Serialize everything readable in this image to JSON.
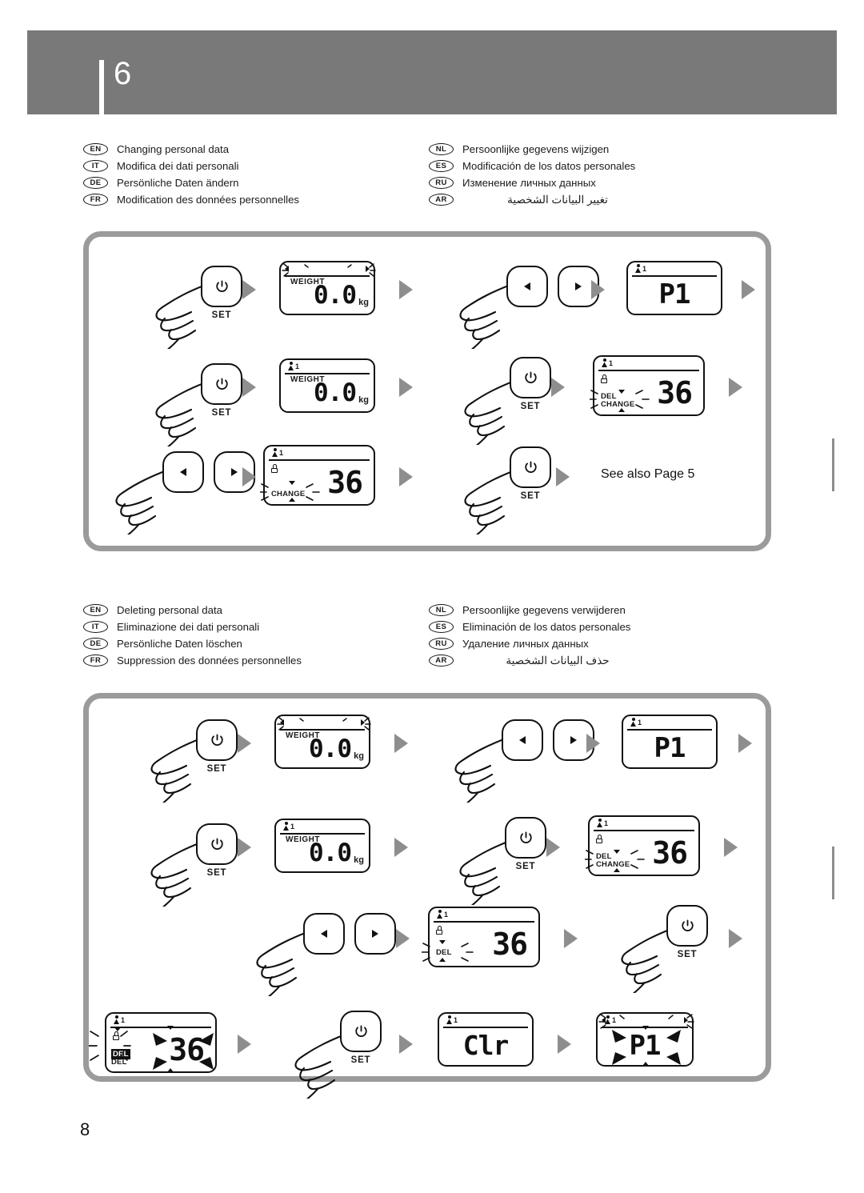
{
  "header": {
    "section_number": "6"
  },
  "page_number": "8",
  "sections": [
    {
      "id": "changing-personal-data",
      "languages_left": [
        {
          "code": "EN",
          "text": "Changing personal data"
        },
        {
          "code": "IT",
          "text": "Modifica dei dati personali"
        },
        {
          "code": "DE",
          "text": "Persönliche Daten ändern"
        },
        {
          "code": "FR",
          "text": "Modification des données personnelles"
        }
      ],
      "languages_right": [
        {
          "code": "NL",
          "text": "Persoonlijke gegevens wijzigen"
        },
        {
          "code": "ES",
          "text": "Modificación de los datos personales"
        },
        {
          "code": "RU",
          "text": "Изменение личных данных"
        },
        {
          "code": "AR",
          "text": "تغيير البيانات الشخصية"
        }
      ],
      "steps": {
        "btn_set_label": "SET",
        "weight_label": "WEIGHT",
        "weight_value": "0.0",
        "weight_unit": "kg",
        "user_index": "1",
        "profile_code": "P1",
        "age_value": "36",
        "label_del": "DEL",
        "label_change": "CHANGE",
        "see_also": "See also Page 5"
      }
    },
    {
      "id": "deleting-personal-data",
      "languages_left": [
        {
          "code": "EN",
          "text": "Deleting personal data"
        },
        {
          "code": "IT",
          "text": "Eliminazione dei dati personali"
        },
        {
          "code": "DE",
          "text": "Persönliche Daten löschen"
        },
        {
          "code": "FR",
          "text": "Suppression des données personnelles"
        }
      ],
      "languages_right": [
        {
          "code": "NL",
          "text": "Persoonlijke gegevens verwijderen"
        },
        {
          "code": "ES",
          "text": "Eliminación de los datos personales"
        },
        {
          "code": "RU",
          "text": "Удаление личных данных"
        },
        {
          "code": "AR",
          "text": "حذف البيانات الشخصية"
        }
      ],
      "steps": {
        "btn_set_label": "SET",
        "weight_label": "WEIGHT",
        "weight_value": "0.0",
        "weight_unit": "kg",
        "user_index": "1",
        "profile_code": "P1",
        "age_value": "36",
        "label_del": "DEL",
        "label_change": "CHANGE",
        "clear_code": "Clr"
      }
    }
  ],
  "colors": {
    "band": "#797979",
    "panel_border": "#9b9b9b",
    "arrow": "#8e8e8e",
    "ink": "#111111"
  }
}
